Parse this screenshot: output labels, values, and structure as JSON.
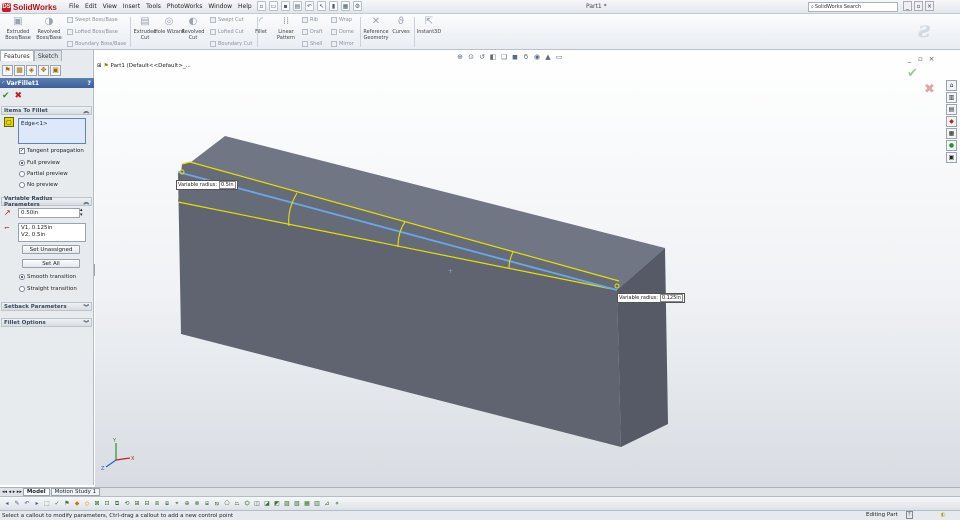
{
  "app": {
    "logo_text": "SolidWorks",
    "doc_title": "Part1 *"
  },
  "menus": [
    "File",
    "Edit",
    "View",
    "Insert",
    "Tools",
    "PhotoWorks",
    "Window",
    "Help"
  ],
  "search": {
    "value": "SolidWorks Search"
  },
  "ribbon": {
    "extruded_boss": "Extruded Boss/Base",
    "revolved_boss": "Revolved Boss/Base",
    "swept_boss": "Swept Boss/Base",
    "lofted_boss": "Lofted Boss/Base",
    "boundary_boss": "Boundary Boss/Base",
    "extruded_cut": "Extruded Cut",
    "hole_wizard": "Hole Wizard",
    "revolved_cut": "Revolved Cut",
    "swept_cut": "Swept Cut",
    "lofted_cut": "Lofted Cut",
    "boundary_cut": "Boundary Cut",
    "fillet": "Fillet",
    "linear_pattern": "Linear Pattern",
    "rib": "Rib",
    "draft": "Draft",
    "shell": "Shell",
    "wrap": "Wrap",
    "dome": "Dome",
    "mirror": "Mirror",
    "ref_geometry": "Reference Geometry",
    "curves": "Curves",
    "instant3d": "Instant3D"
  },
  "panel": {
    "tabs": [
      "Features",
      "Sketch"
    ],
    "feature_title": "VarFillet1",
    "help_glyph": "?",
    "items_group": "Items To Fillet",
    "edge_item": "Edge<1>",
    "tangent_propagation": "Tangent propagation",
    "full_preview": "Full preview",
    "partial_preview": "Partial preview",
    "no_preview": "No preview",
    "vr_group": "Variable Radius Parameters",
    "radius_value": "0.50in",
    "v1": "V1, 0.125in",
    "v2": "V2, 0.5in",
    "set_unassigned": "Set Unassigned",
    "set_all": "Set All",
    "smooth_transition": "Smooth transition",
    "straight_transition": "Straight transition",
    "setback_group": "Setback Parameters",
    "options_group": "Fillet Options"
  },
  "viewport": {
    "tree_node": "Part1  (Default<<Default>_...",
    "callout_left": {
      "label": "Variable radius:",
      "value": "0.5in"
    },
    "callout_right": {
      "label": "Variable radius:",
      "value": "0.125in"
    }
  },
  "bottom_tabs": [
    "Model",
    "Motion Study 1"
  ],
  "status": {
    "message": "Select a callout to modify parameters, Ctrl-drag a callout to add a new control point",
    "mode": "Editing Part"
  },
  "colors": {
    "accent": "#3c5f96",
    "fillet_edge": "#e8e000",
    "selected_edge": "#6aa7e8",
    "ok_green": "#2f8f2f",
    "cancel_red": "#c41c22"
  }
}
